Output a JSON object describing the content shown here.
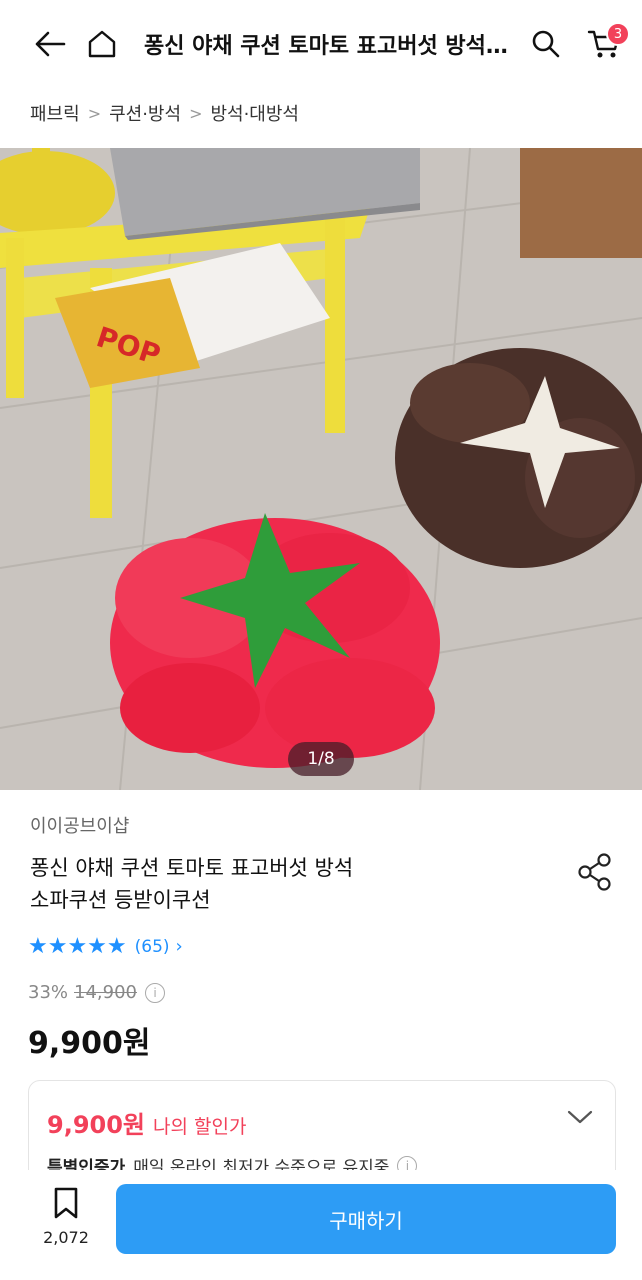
{
  "header": {
    "title": "퐁신 야채 쿠션 토마토 표고버섯 방석 소파쿠션 등받이쿠션",
    "cart_count": "3",
    "icons": [
      "back-arrow-icon",
      "home-icon",
      "search-icon",
      "cart-icon"
    ]
  },
  "breadcrumb": {
    "items": [
      "패브릭",
      "쿠션·방석",
      "방석·대방석"
    ]
  },
  "gallery": {
    "counter": "1/8"
  },
  "product": {
    "seller": "이이공브이샵",
    "name_line1": "퐁신 야채 쿠션 토마토 표고버섯 방석",
    "name_line2": "소파쿠션 등받이쿠션",
    "rating_stars": "★★★★★",
    "rating_value": 5,
    "review_count": "(65)",
    "discount_rate": "33%",
    "original_price": "14,900",
    "final_price": "9,900원"
  },
  "discount_card": {
    "my_price": "9,900원",
    "my_price_label": "나의 할인가",
    "cert_label": "특별인증가",
    "cert_desc": "매일 온라인 최저가 수준으로 유지중"
  },
  "bottom_bar": {
    "wish_count": "2,072",
    "buy_label": "구매하기"
  },
  "colors": {
    "accent_blue": "#2d9cf5",
    "accent_red": "#f2415a"
  }
}
